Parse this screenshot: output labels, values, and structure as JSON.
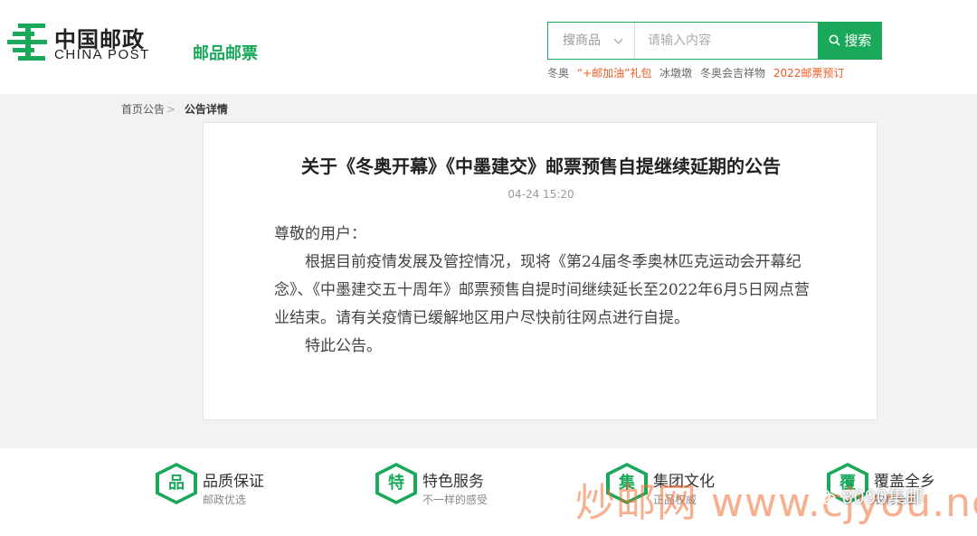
{
  "header": {
    "logo_cn": "中国邮政",
    "logo_en": "CHINA POST",
    "product_nav": "邮品邮票"
  },
  "search": {
    "category": "搜商品",
    "placeholder": "请输入内容",
    "button_label": "搜索",
    "hot_words": [
      "冬奥",
      "“+邮加油”礼包",
      "冰墩墩",
      "冬奥会吉祥物",
      "2022邮票预订"
    ]
  },
  "breadcrumb": {
    "home": "首页公告",
    "current": "公告详情"
  },
  "article": {
    "title": "关于《冬奥开幕》《中墨建交》邮票预售自提继续延期的公告",
    "date": "04-24 15:20",
    "greeting": "尊敬的用户：",
    "paragraph": "根据目前疫情发展及管控情况，现将《第24届冬季奥林匹克运动会开幕纪念》、《中墨建交五十周年》邮票预售自提时间继续延长至2022年6月5日网点营业结束。请有关疫情已缓解地区用户尽快前往网点进行自提。",
    "closing": "特此公告。"
  },
  "features": [
    {
      "icon": "品",
      "title": "品质保证",
      "subtitle": "邮政优选"
    },
    {
      "icon": "特",
      "title": "特色服务",
      "subtitle": "不一样的感受"
    },
    {
      "icon": "集",
      "title": "集团文化",
      "subtitle": "正品权威"
    },
    {
      "icon": "覆",
      "title": "覆盖全乡",
      "subtitle": "农村全覆"
    }
  ],
  "overlay": {
    "watermark": "炒邮网 www.cjyou.net",
    "wechat": "8090集邮"
  },
  "colors": {
    "brand_green": "#1aa85a",
    "hot_orange": "#f15a22"
  }
}
